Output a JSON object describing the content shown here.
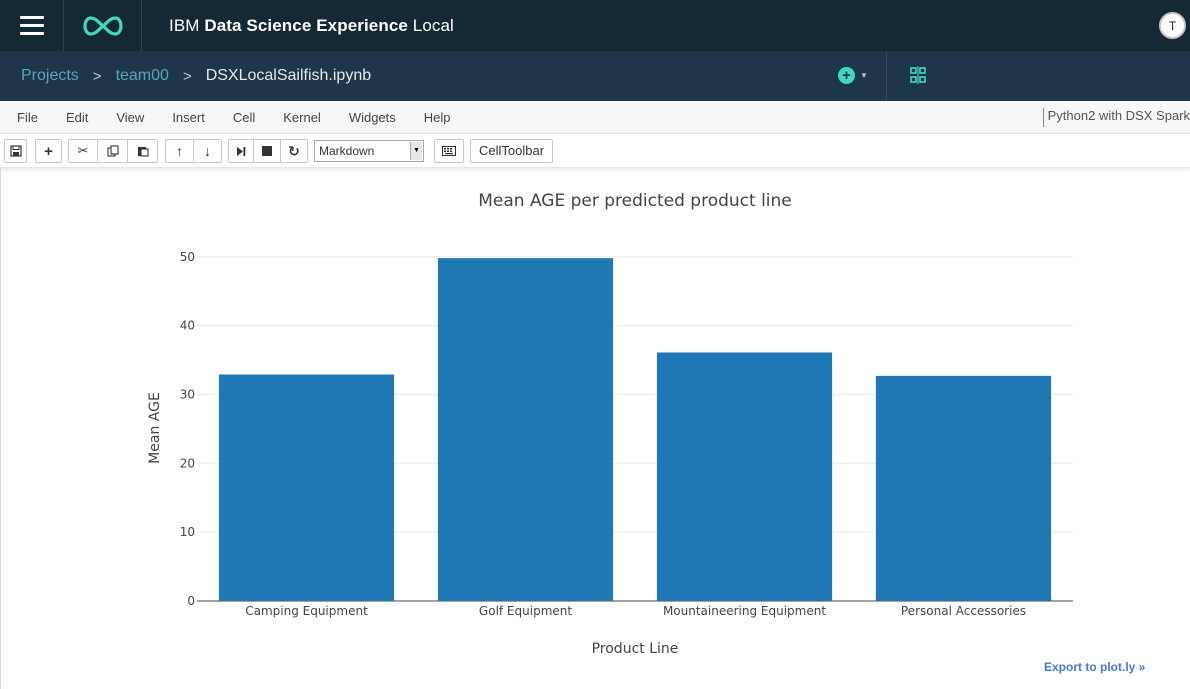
{
  "app": {
    "title_prefix": "IBM",
    "title_bold": "Data Science Experience",
    "title_suffix": "Local",
    "user_initial": "T"
  },
  "breadcrumb": {
    "items": [
      "Projects",
      "team00"
    ],
    "current": "DSXLocalSailfish.ipynb",
    "separator": ">"
  },
  "menu": {
    "items": [
      "File",
      "Edit",
      "View",
      "Insert",
      "Cell",
      "Kernel",
      "Widgets",
      "Help"
    ],
    "kernel": "Python2 with DSX Spark"
  },
  "toolbar": {
    "cell_type": "Markdown",
    "celltoolbar_label": "CellToolbar"
  },
  "chart_data": {
    "type": "bar",
    "title": "Mean AGE per predicted product line",
    "xlabel": "Product Line",
    "ylabel": "Mean AGE",
    "categories": [
      "Camping Equipment",
      "Golf Equipment",
      "Mountaineering Equipment",
      "Personal Accessories"
    ],
    "values": [
      32.9,
      49.8,
      36.1,
      32.7
    ],
    "ylim": [
      0,
      52
    ],
    "yticks": [
      0,
      10,
      20,
      30,
      40,
      50
    ],
    "grid": true,
    "bar_color": "#1f77b4"
  },
  "export_label": "Export to plot.ly »",
  "colors": {
    "topbar": "#152935",
    "crumbbar": "#1d3649",
    "accent": "#41d6c3",
    "link": "#5aa5b8"
  }
}
